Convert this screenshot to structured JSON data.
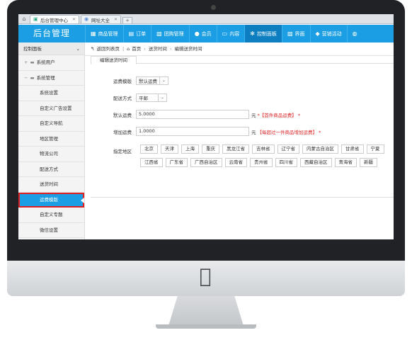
{
  "browser": {
    "tabs": [
      {
        "label": "后台管理中心",
        "active": true
      },
      {
        "label": "网址大全",
        "active": false
      }
    ],
    "new_tab": "+"
  },
  "header": {
    "brand": "后台管理",
    "nav": [
      {
        "label": "商品管理",
        "icon": "bag-icon"
      },
      {
        "label": "订单",
        "icon": "cart-icon"
      },
      {
        "label": "团购管理",
        "icon": "group-icon"
      },
      {
        "label": "会员",
        "icon": "user-icon"
      },
      {
        "label": "内容",
        "icon": "monitor-icon"
      },
      {
        "label": "控制面板",
        "icon": "gear-icon",
        "active": true
      },
      {
        "label": "界面",
        "icon": "image-icon"
      },
      {
        "label": "营销活动",
        "icon": "tag-icon"
      },
      {
        "label": "",
        "icon": "users-icon"
      }
    ]
  },
  "sidebar": {
    "title": "控制面板",
    "items": [
      {
        "label": "系统用户",
        "group": true,
        "toggle": "+"
      },
      {
        "label": "系统管理",
        "group": true,
        "toggle": "−"
      },
      {
        "label": "系统设置"
      },
      {
        "label": "自定义广告设置"
      },
      {
        "label": "自定义导航"
      },
      {
        "label": "地区管理"
      },
      {
        "label": "物流公司"
      },
      {
        "label": "配送方式"
      },
      {
        "label": "送货时间"
      },
      {
        "label": "运费模版",
        "active": true
      },
      {
        "label": "自定义专题"
      },
      {
        "label": "微信设置"
      }
    ]
  },
  "breadcrumb": {
    "items": [
      "返回列表页",
      "首页",
      "送货时间",
      "编辑送货时间"
    ]
  },
  "form": {
    "tab": "编辑送货时间",
    "template_label": "运费模版",
    "template_value": "默认运费",
    "method_label": "配送方式",
    "method_value": "平邮",
    "default_fee_label": "默认运费",
    "default_fee_value": "5.0000",
    "default_fee_unit": "元",
    "default_fee_tip": "*【首件商品运费】  *",
    "extra_fee_label": "增加运费",
    "extra_fee_value": "1.0000",
    "extra_fee_unit": "元",
    "extra_fee_tip": "【每超过一件商品增加运费】  *",
    "region_label": "指定地区",
    "regions": [
      "北京",
      "天津",
      "上海",
      "重庆",
      "黑龙江省",
      "吉林省",
      "辽宁省",
      "内蒙古自治区",
      "甘肃省",
      "宁夏",
      "江西省",
      "广东省",
      "广西自治区",
      "云南省",
      "贵州省",
      "四川省",
      "西藏自治区",
      "青海省",
      "新疆"
    ]
  }
}
